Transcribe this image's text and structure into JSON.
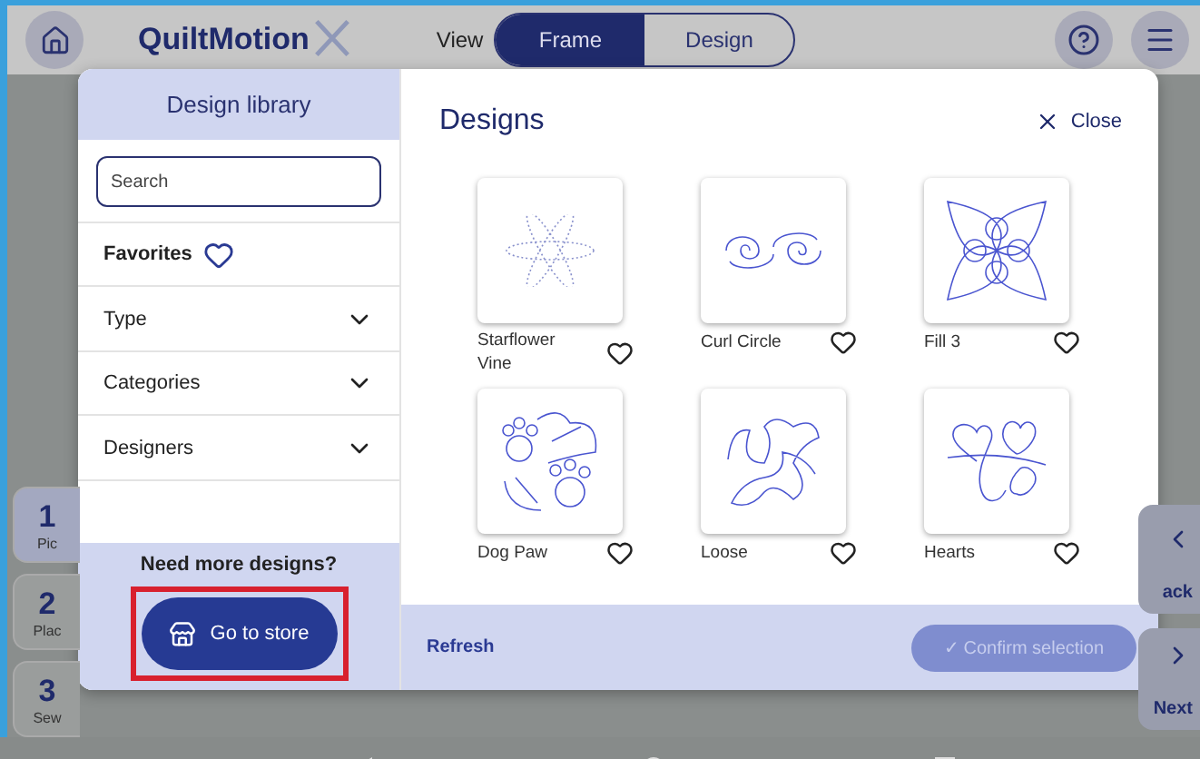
{
  "top_bar": {
    "brand": "QuiltMotion",
    "view_label": "View",
    "view_tabs": [
      {
        "label": "Frame",
        "selected": true
      },
      {
        "label": "Design",
        "selected": false
      }
    ]
  },
  "steps": [
    {
      "number": "1",
      "label": "Pic",
      "selected": true
    },
    {
      "number": "2",
      "label": "Plac",
      "selected": false
    },
    {
      "number": "3",
      "label": "Sew",
      "selected": false
    }
  ],
  "right_nav": {
    "back_label": "ack",
    "next_label": "Next"
  },
  "library": {
    "title": "Design library",
    "search": {
      "placeholder": "Search"
    },
    "favorites": {
      "label": "Favorites",
      "on": false
    },
    "filters": [
      {
        "label": "Type",
        "expanded": false
      },
      {
        "label": "Categories",
        "expanded": false
      },
      {
        "label": "Designers",
        "expanded": false
      }
    ],
    "promo": "Need more designs?",
    "store_button": "Go to store",
    "store_highlighted": true
  },
  "designs_panel": {
    "title": "Designs",
    "close": "Close",
    "designs": [
      {
        "name": "Starflower Vine",
        "kind": "starflower",
        "favorite": false
      },
      {
        "name": "Curl Circle",
        "kind": "curls",
        "favorite": false
      },
      {
        "name": "Fill 3",
        "kind": "petals",
        "favorite": false
      },
      {
        "name": "Dog Paw",
        "kind": "paws",
        "favorite": false
      },
      {
        "name": "Loose",
        "kind": "meander",
        "favorite": false
      },
      {
        "name": "Hearts",
        "kind": "hearts",
        "favorite": false
      }
    ],
    "refresh": "Refresh",
    "confirm": {
      "label": "✓ Confirm selection",
      "disabled": true
    }
  }
}
